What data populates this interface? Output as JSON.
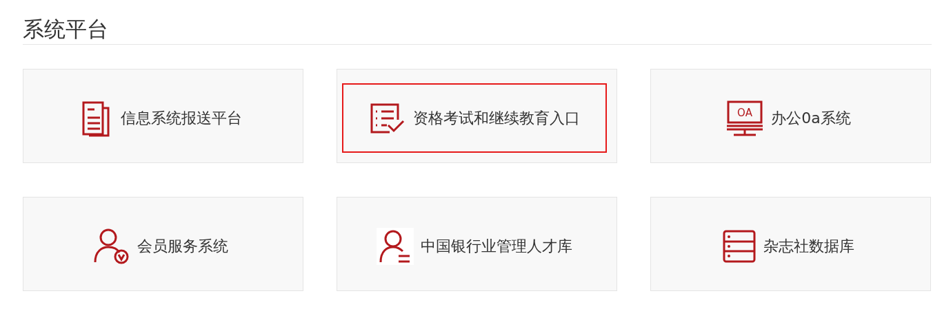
{
  "title": "系统平台",
  "cards": [
    {
      "kind": "document",
      "label": "信息系统报送平台",
      "selected": false
    },
    {
      "kind": "checklist",
      "label": "资格考试和继续教育入口",
      "selected": true
    },
    {
      "kind": "monitor",
      "icon_text": "OA",
      "label": "办公0a系统",
      "selected": false
    },
    {
      "kind": "member",
      "label": "会员服务系统",
      "selected": false
    },
    {
      "kind": "talent",
      "label": "中国银行业管理人才库",
      "selected": false
    },
    {
      "kind": "database",
      "label": "杂志社数据库",
      "selected": false
    }
  ]
}
